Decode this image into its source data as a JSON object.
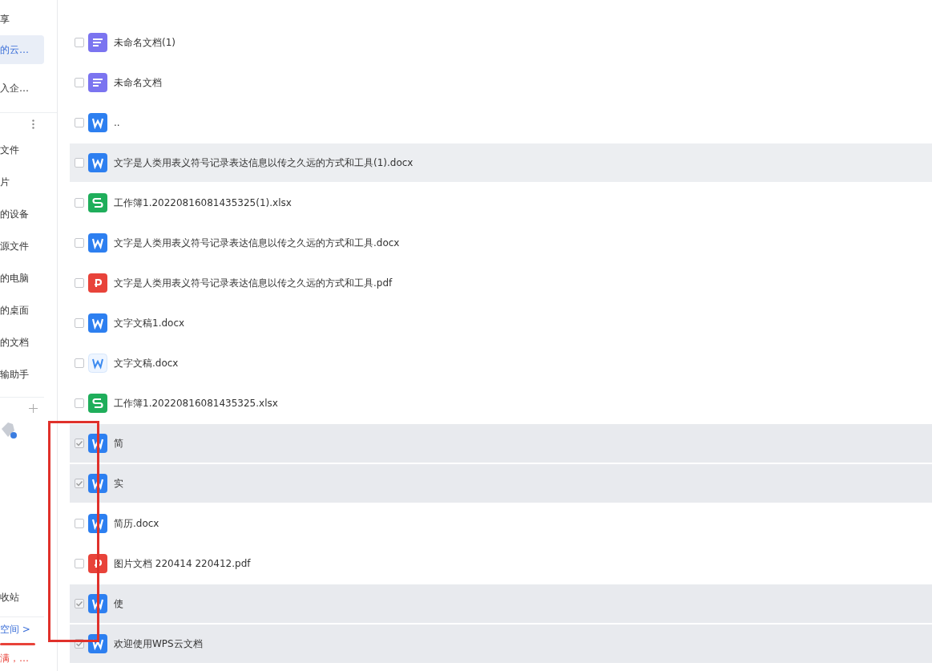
{
  "sidebar": {
    "top_items": [
      {
        "label": "享",
        "selected": false
      },
      {
        "label": "的云…",
        "selected": true
      },
      {
        "label": "入企…",
        "selected": false
      }
    ],
    "section_items": [
      {
        "label": "文件"
      },
      {
        "label": "片"
      },
      {
        "label": "的设备"
      },
      {
        "label": "源文件"
      },
      {
        "label": "的电脑"
      },
      {
        "label": "的桌面"
      },
      {
        "label": "的文档"
      },
      {
        "label": "输助手"
      }
    ],
    "bottom_item": "收站",
    "space_link": "空间",
    "space_chevron": ">",
    "warning": "满，…"
  },
  "files": [
    {
      "kind": "doc",
      "name": "未命名文档(1)",
      "checked": false,
      "hovered": false
    },
    {
      "kind": "doc",
      "name": "未命名文档",
      "checked": false,
      "hovered": false
    },
    {
      "kind": "word",
      "name": "..",
      "checked": false,
      "hovered": false
    },
    {
      "kind": "word",
      "name": "文字是人类用表义符号记录表达信息以传之久远的方式和工具(1).docx",
      "checked": false,
      "hovered": true
    },
    {
      "kind": "sheet",
      "name": "工作簿1.20220816081435325(1).xlsx",
      "checked": false,
      "hovered": false
    },
    {
      "kind": "word",
      "name": "文字是人类用表义符号记录表达信息以传之久远的方式和工具.docx",
      "checked": false,
      "hovered": false
    },
    {
      "kind": "pdf",
      "name": "文字是人类用表义符号记录表达信息以传之久远的方式和工具.pdf",
      "checked": false,
      "hovered": false
    },
    {
      "kind": "word",
      "name": "文字文稿1.docx",
      "checked": false,
      "hovered": false
    },
    {
      "kind": "word-plain",
      "name": "文字文稿.docx",
      "checked": false,
      "hovered": false
    },
    {
      "kind": "sheet",
      "name": "工作簿1.20220816081435325.xlsx",
      "checked": false,
      "hovered": false
    },
    {
      "kind": "word",
      "name": "简",
      "checked": true,
      "hovered": false
    },
    {
      "kind": "word",
      "name": "实",
      "checked": true,
      "hovered": false
    },
    {
      "kind": "word",
      "name": "简历.docx",
      "checked": false,
      "hovered": false
    },
    {
      "kind": "pdf",
      "name": "图片文档 220414 220412.pdf",
      "checked": false,
      "hovered": false
    },
    {
      "kind": "word",
      "name": "使",
      "checked": true,
      "hovered": false
    },
    {
      "kind": "word",
      "name": "欢迎使用WPS云文档",
      "checked": true,
      "hovered": false
    }
  ]
}
